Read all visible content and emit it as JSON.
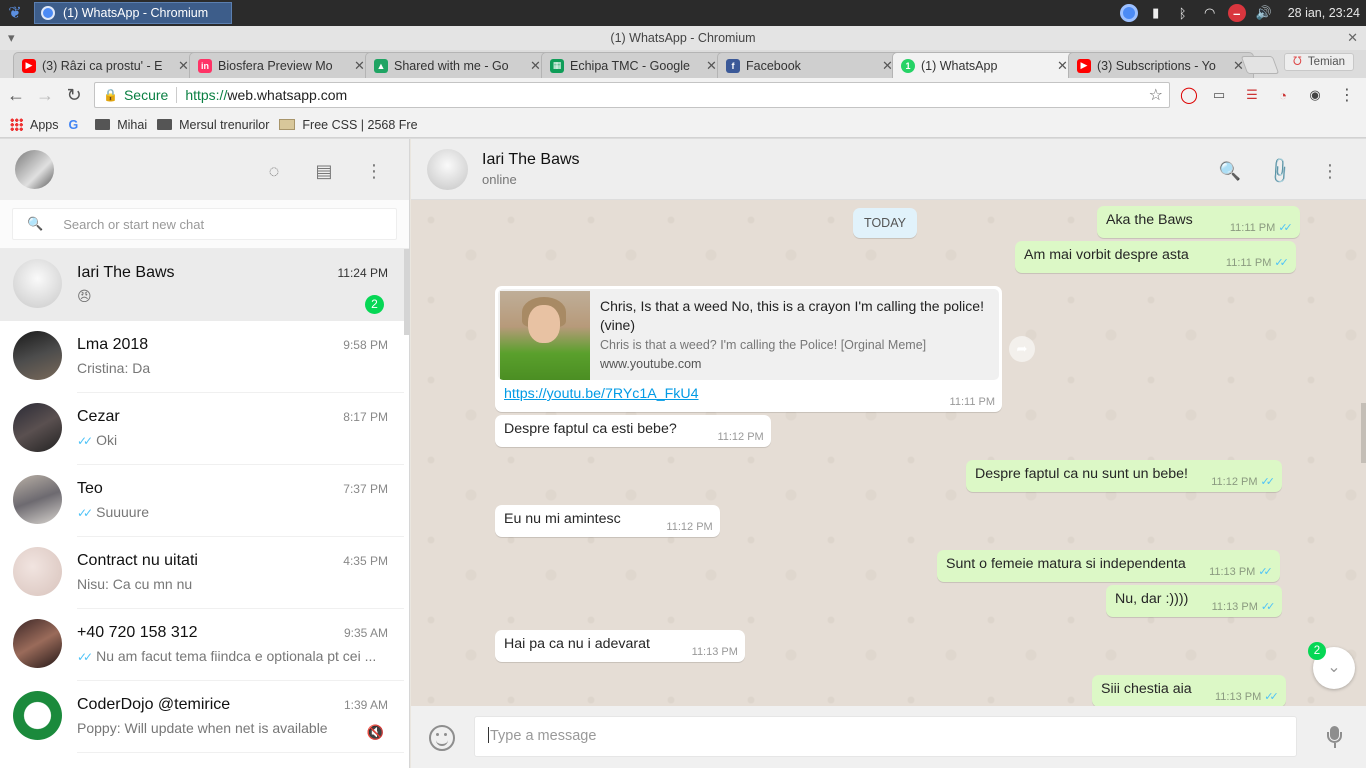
{
  "taskbar": {
    "task_label": "(1) WhatsApp - Chromium",
    "clock": "28 ian, 23:24"
  },
  "window": {
    "title": "(1) WhatsApp - Chromium"
  },
  "tabs": [
    {
      "label": "(3) Râzi ca prostu' - E",
      "icon": "youtube-icon",
      "color": "#ff0000"
    },
    {
      "label": "Biosfera Preview Mo",
      "icon": "invision-icon",
      "color": "#ff3366"
    },
    {
      "label": "Shared with me - Go",
      "icon": "google-drive-icon",
      "color": "#1fa463"
    },
    {
      "label": "Echipa TMC - Google",
      "icon": "google-sheets-icon",
      "color": "#0f9d58"
    },
    {
      "label": "Facebook",
      "icon": "facebook-icon",
      "color": "#3b5998"
    },
    {
      "label": "(1) WhatsApp",
      "icon": "whatsapp-icon",
      "color": "#25d366"
    },
    {
      "label": "(3) Subscriptions - Yo",
      "icon": "youtube-icon",
      "color": "#ff0000"
    }
  ],
  "profile": {
    "label": "Temian"
  },
  "omnibox": {
    "secure_label": "Secure",
    "scheme": "https://",
    "host": "web.whatsapp.com"
  },
  "bookmarks": [
    {
      "label": "Apps",
      "icon": "apps-grid-icon"
    },
    {
      "label": "",
      "icon": "google-icon"
    },
    {
      "label": "Mihai",
      "icon": "folder-icon"
    },
    {
      "label": "Mersul trenurilor",
      "icon": "folder-icon"
    },
    {
      "label": "Free CSS | 2568 Fre",
      "icon": "css-icon"
    }
  ],
  "left": {
    "search_placeholder": "Search or start new chat",
    "chats": [
      {
        "name": "Iari The Baws",
        "time": "11:24 PM",
        "message": "😠",
        "ticks": false,
        "badge": "2",
        "selected": true
      },
      {
        "name": "Lma 2018",
        "time": "9:58 PM",
        "message": "Cristina: Da",
        "ticks": false
      },
      {
        "name": "Cezar",
        "time": "8:17 PM",
        "message": "Oki",
        "ticks": true
      },
      {
        "name": "Teo",
        "time": "7:37 PM",
        "message": "Suuuure",
        "ticks": true
      },
      {
        "name": "Contract nu uitati",
        "time": "4:35 PM",
        "message": "Nisu: Ca cu mn nu",
        "ticks": false
      },
      {
        "name": "+40 720 158 312",
        "time": "9:35 AM",
        "message": "Nu am facut tema fiindca e optionala pt cei ...",
        "ticks": true
      },
      {
        "name": "CoderDojo @temirice",
        "time": "1:39 AM",
        "message": "Poppy: Will update when net is available",
        "ticks": false,
        "muted": true
      }
    ]
  },
  "right": {
    "contact_name": "Iari The Baws",
    "contact_status": "online",
    "date_chip": "TODAY",
    "messages": [
      {
        "dir": "out",
        "text": "Aka the Baws",
        "time": "11:11 PM"
      },
      {
        "dir": "out",
        "text": "Am mai vorbit despre asta",
        "time": "11:11 PM"
      },
      {
        "dir": "in",
        "text": "Despre faptul ca esti bebe?",
        "time": "11:12 PM"
      },
      {
        "dir": "out",
        "text": "Despre faptul ca nu sunt un bebe!",
        "time": "11:12 PM"
      },
      {
        "dir": "in",
        "text": "Eu nu mi amintesc",
        "time": "11:12 PM"
      },
      {
        "dir": "out",
        "text": "Sunt o femeie matura si independenta",
        "time": "11:13 PM"
      },
      {
        "dir": "out",
        "text": "Nu, dar :))))",
        "time": "11:13 PM"
      },
      {
        "dir": "in",
        "text": "Hai pa ca nu i adevarat",
        "time": "11:13 PM"
      },
      {
        "dir": "out",
        "text": "Siii chestia aia",
        "time": "11:13 PM"
      }
    ],
    "link_message": {
      "title": "Chris, Is that a weed No, this is a crayon I'm calling the police! (vine)",
      "description": "Chris is that a weed? I'm calling the Police! [Orginal Meme]",
      "domain": "www.youtube.com",
      "url": "https://youtu.be/7RYc1A_FkU4",
      "time": "11:11 PM"
    },
    "unread_badge": "2",
    "composer_placeholder": "Type a message"
  },
  "colors": {
    "outgoing_bubble": "#dcf8c6",
    "incoming_bubble": "#ffffff",
    "unread_badge": "#06d755",
    "read_ticks": "#4fc3f7",
    "link": "#039be5"
  }
}
